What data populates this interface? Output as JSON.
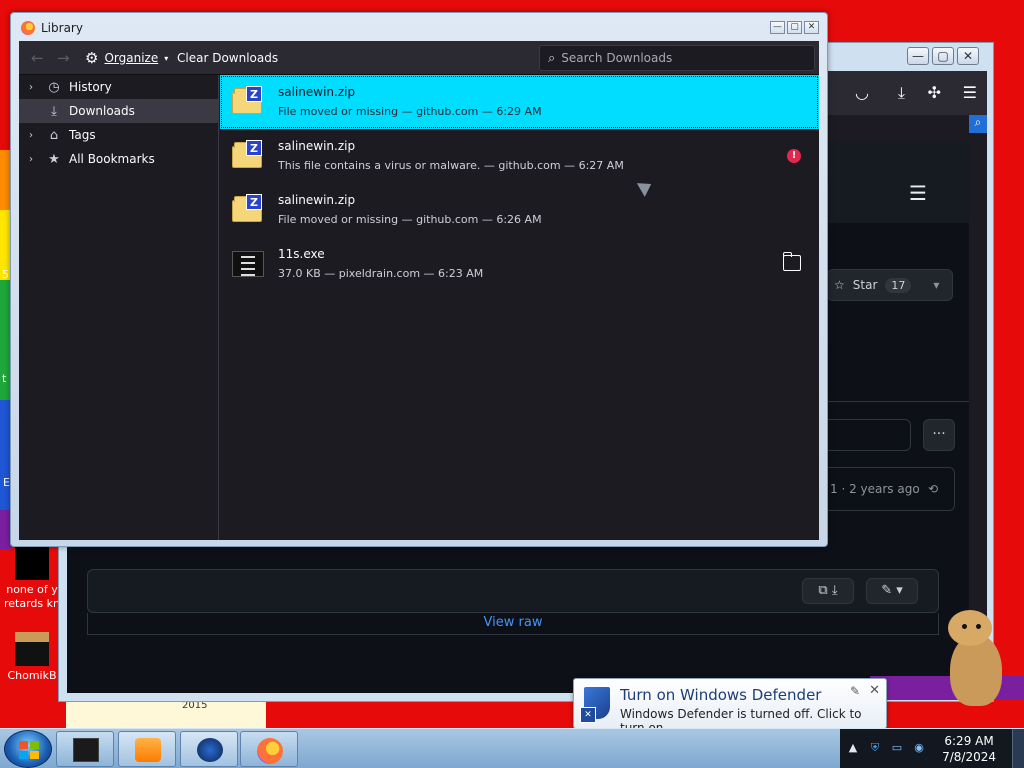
{
  "desktop": {
    "icons": [
      {
        "label": "none of y retards kn"
      },
      {
        "label": "ChomikB"
      }
    ],
    "year_label": "2015",
    "edge_letters": [
      "5",
      "t",
      "E"
    ]
  },
  "background_browser": {
    "github": {
      "star_label": "Star",
      "star_count": "17",
      "commit_info": "1 · 2 years ago",
      "view_raw": "View raw"
    }
  },
  "library": {
    "title": "Library",
    "toolbar": {
      "organize": "Organize",
      "clear_downloads": "Clear Downloads",
      "search_placeholder": "Search Downloads"
    },
    "sidebar": [
      {
        "label": "History",
        "icon": "history-icon",
        "expandable": true,
        "selected": false
      },
      {
        "label": "Downloads",
        "icon": "download-icon",
        "expandable": false,
        "selected": true
      },
      {
        "label": "Tags",
        "icon": "tag-icon",
        "expandable": true,
        "selected": false
      },
      {
        "label": "All Bookmarks",
        "icon": "star-icon",
        "expandable": true,
        "selected": false
      }
    ],
    "downloads": [
      {
        "name": "salinewin.zip",
        "meta": "File moved or missing — github.com — 6:29 AM",
        "icon": "zip-archive-icon",
        "selected": true,
        "action": "none"
      },
      {
        "name": "salinewin.zip",
        "meta": "This file contains a virus or malware. — github.com — 6:27 AM",
        "icon": "zip-archive-icon",
        "selected": false,
        "action": "warning"
      },
      {
        "name": "salinewin.zip",
        "meta": "File moved or missing — github.com — 6:26 AM",
        "icon": "zip-archive-icon",
        "selected": false,
        "action": "none"
      },
      {
        "name": "11s.exe",
        "meta": "37.0 KB — pixeldrain.com — 6:23 AM",
        "icon": "executable-icon",
        "selected": false,
        "action": "open-folder"
      }
    ]
  },
  "notification": {
    "title": "Turn on Windows Defender",
    "text": "Windows Defender is turned off. Click to turn on."
  },
  "taskbar": {
    "clock_time": "6:29 AM",
    "clock_date": "7/8/2024"
  },
  "colors": {
    "selection": "#00ddff",
    "warning": "#e22850",
    "ff_bg": "#1c1b22",
    "desktop_red": "#e60a0a"
  }
}
